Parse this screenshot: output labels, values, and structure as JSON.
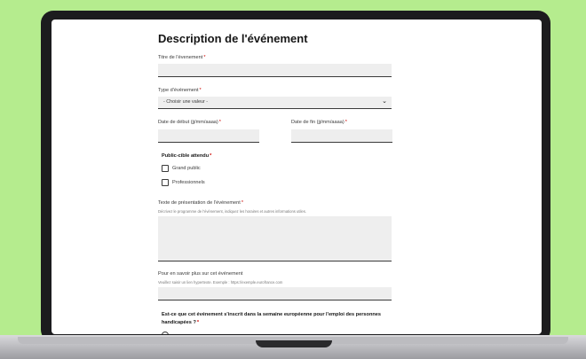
{
  "form": {
    "title": "Description de l'événement",
    "required_mark": "*",
    "event_title": {
      "label": "Titre de l'évenement"
    },
    "event_type": {
      "label": "Type d'événement",
      "selected": "- Choisir une valeur -"
    },
    "start_date": {
      "label": "Date de début (jj/mm/aaaa)"
    },
    "end_date": {
      "label": "Date de fin (jj/mm/aaaa)"
    },
    "audience": {
      "label": "Public-cible attendu",
      "options": [
        "Grand public",
        "Professionnels"
      ]
    },
    "presentation": {
      "label": "Texte de présentation de l'événement",
      "hint": "Décrivez le programme de l'événement, indiquez les horaires et autres informations utiles."
    },
    "more_info": {
      "label": "Pour en savoir plus sur cet événement",
      "hint": "Veuillez saisir un lien hypertexte. Exemple : https://exemple.eurofrance.com"
    },
    "european_week": {
      "label_line1": "Est-ce que cet événement s'inscrit dans la semaine européenne pour l'emploi des personnes",
      "label_line2": "handicapées ?"
    }
  },
  "icons": {
    "select_chevron": "chevron-down-icon"
  }
}
